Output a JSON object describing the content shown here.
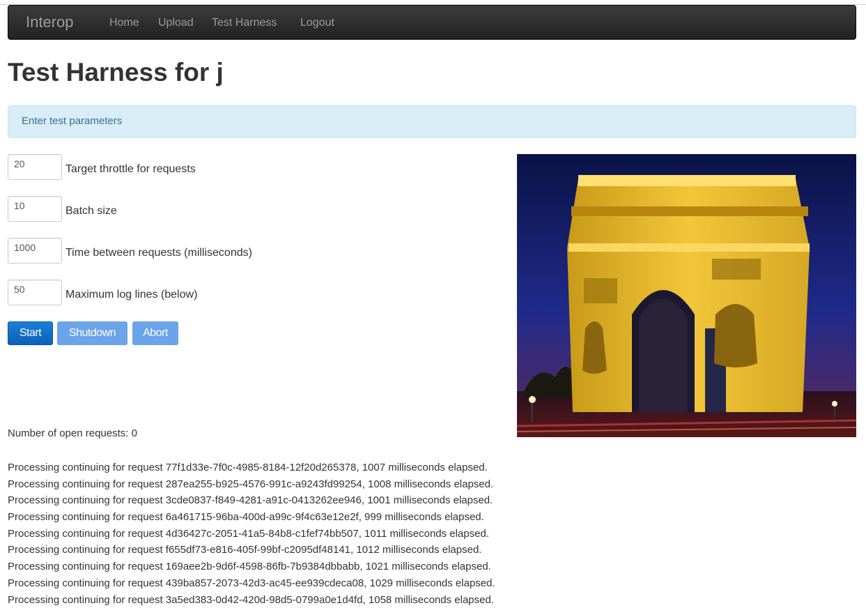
{
  "navbar": {
    "brand": "Interop",
    "links": [
      "Home",
      "Upload",
      "Test Harness",
      "Logout"
    ]
  },
  "page": {
    "title": "Test Harness for j",
    "alert": "Enter test parameters"
  },
  "form": {
    "fields": [
      {
        "value": "20",
        "label": "Target throttle for requests"
      },
      {
        "value": "10",
        "label": "Batch size"
      },
      {
        "value": "1000",
        "label": "Time between requests (milliseconds)"
      },
      {
        "value": "50",
        "label": "Maximum log lines (below)"
      }
    ],
    "buttons": {
      "start": "Start",
      "shutdown": "Shutdown",
      "abort": "Abort"
    }
  },
  "status": {
    "open_requests": "Number of open requests: 0"
  },
  "log": [
    "Processing continuing for request 77f1d33e-7f0c-4985-8184-12f20d265378, 1007 milliseconds elapsed.",
    "Processing continuing for request 287ea255-b925-4576-991c-a9243fd99254, 1008 milliseconds elapsed.",
    "Processing continuing for request 3cde0837-f849-4281-a91c-0413262ee946, 1001 milliseconds elapsed.",
    "Processing continuing for request 6a461715-96ba-400d-a99c-9f4c63e12e2f, 999 milliseconds elapsed.",
    "Processing continuing for request 4d36427c-2051-41a5-84b8-c1fef74bb507, 1011 milliseconds elapsed.",
    "Processing continuing for request f655df73-e816-405f-99bf-c2095df48141, 1012 milliseconds elapsed.",
    "Processing continuing for request 169aee2b-9d6f-4598-86fb-7b9384dbbabb, 1021 milliseconds elapsed.",
    "Processing continuing for request 439ba857-2073-42d3-ac45-ee939cdeca08, 1029 milliseconds elapsed.",
    "Processing continuing for request 3a5ed383-0d42-420d-98d5-0799a0e1d4fd, 1058 milliseconds elapsed."
  ]
}
